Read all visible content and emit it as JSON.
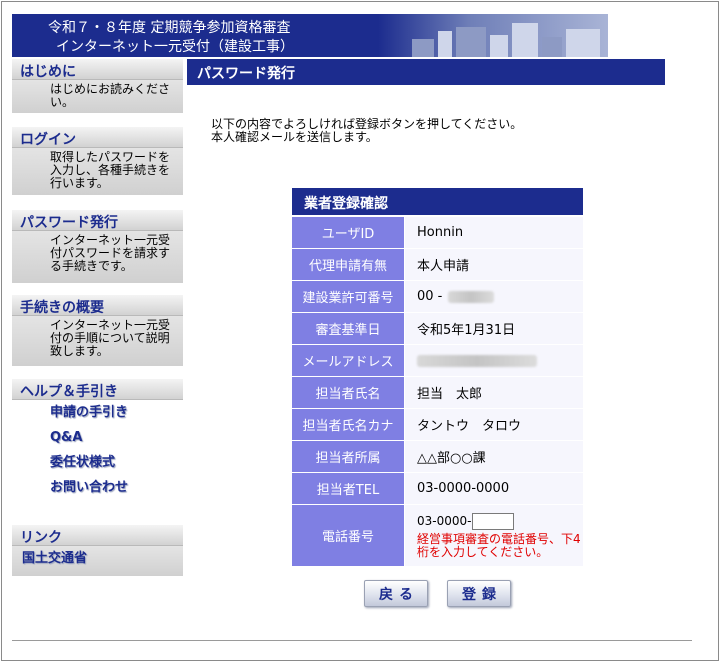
{
  "banner": {
    "line1": "令和７・８年度 定期競争参加資格審査",
    "line2": "インターネット一元受付（建設工事）"
  },
  "sidebar": {
    "intro": {
      "heading": "はじめに",
      "text": "はじめにお読みください。"
    },
    "login": {
      "heading": "ログイン",
      "text": "取得したパスワードを入力し、各種手続きを行います。"
    },
    "password": {
      "heading": "パスワード発行",
      "text": "インターネット一元受付パスワードを請求する手続きです。"
    },
    "overview": {
      "heading": "手続きの概要",
      "text": "インターネット一元受付の手順について説明致します。"
    },
    "help": {
      "heading": "ヘルプ＆手引き",
      "links": [
        "申請の手引き",
        "Q&A",
        "委任状様式",
        "お問い合わせ"
      ]
    },
    "links": {
      "heading": "リンク",
      "items": [
        "国土交通省"
      ]
    }
  },
  "main": {
    "title": "パスワード発行",
    "intro_line1": "以下の内容でよろしければ登録ボタンを押してください。",
    "intro_line2": "本人確認メールを送信します。"
  },
  "table": {
    "title": "業者登録確認",
    "rows": [
      {
        "label": "ユーザID",
        "value": "Honnin"
      },
      {
        "label": "代理申請有無",
        "value": "本人申請"
      },
      {
        "label": "建設業許可番号",
        "value": "00 -"
      },
      {
        "label": "審査基準日",
        "value": "令和5年1月31日"
      },
      {
        "label": "メールアドレス",
        "value": ""
      },
      {
        "label": "担当者氏名",
        "value": "担当　太郎"
      },
      {
        "label": "担当者氏名カナ",
        "value": "タントウ　タロウ"
      },
      {
        "label": "担当者所属",
        "value": "△△部○○課"
      },
      {
        "label": "担当者TEL",
        "value": "03-0000-0000"
      },
      {
        "label": "電話番号",
        "value": "03-0000-"
      }
    ],
    "phone_input_value": "",
    "phone_note": "経営事項審査の電話番号、下4桁を入力してください。"
  },
  "buttons": {
    "back": "戻る",
    "register": "登録"
  },
  "colors": {
    "navy": "#1c2c8e",
    "label_bg": "#7f7fe3",
    "value_bg": "#f6f6fd",
    "note_red": "#e00000"
  }
}
